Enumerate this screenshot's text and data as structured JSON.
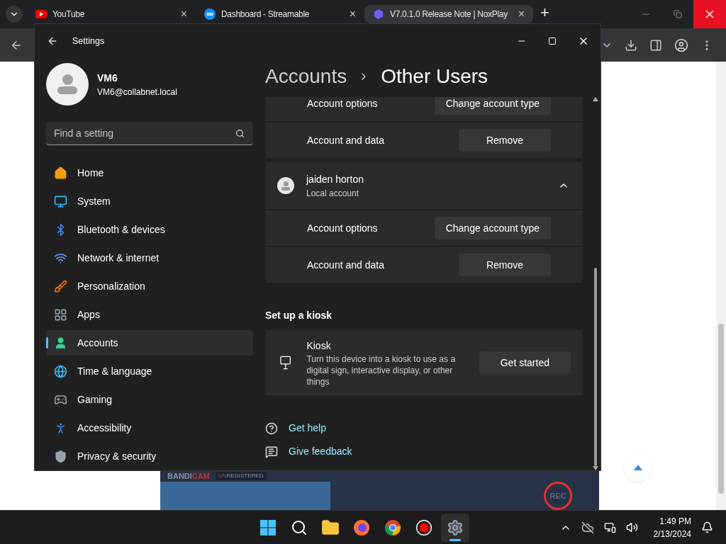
{
  "browser": {
    "tabs": [
      {
        "label": "YouTube",
        "selected": false,
        "close": "×"
      },
      {
        "label": "Dashboard - Streamable",
        "selected": false,
        "close": "×"
      },
      {
        "label": "V7.0.1.0 Release Note | NoxPlay",
        "selected": true,
        "close": "×"
      }
    ],
    "new_tab": "+"
  },
  "settings": {
    "title": "Settings",
    "profile": {
      "name": "VM6",
      "email": "VM6@collabnet.local"
    },
    "search": {
      "placeholder": "Find a setting"
    },
    "nav": [
      {
        "label": "Home",
        "selected": false
      },
      {
        "label": "System",
        "selected": false
      },
      {
        "label": "Bluetooth & devices",
        "selected": false
      },
      {
        "label": "Network & internet",
        "selected": false
      },
      {
        "label": "Personalization",
        "selected": false
      },
      {
        "label": "Apps",
        "selected": false
      },
      {
        "label": "Accounts",
        "selected": true
      },
      {
        "label": "Time & language",
        "selected": false
      },
      {
        "label": "Gaming",
        "selected": false
      },
      {
        "label": "Accessibility",
        "selected": false
      },
      {
        "label": "Privacy & security",
        "selected": false
      }
    ],
    "breadcrumb": [
      "Accounts",
      "Other Users"
    ],
    "previous_user_rows": [
      {
        "label": "Account options",
        "button": "Change account type"
      },
      {
        "label": "Account and data",
        "button": "Remove"
      }
    ],
    "user": {
      "name": "jaiden horton",
      "subtitle": "Local account",
      "expanded": true,
      "rows": [
        {
          "label": "Account options",
          "button": "Change account type"
        },
        {
          "label": "Account and data",
          "button": "Remove"
        }
      ]
    },
    "kiosk": {
      "heading": "Set up a kiosk",
      "title": "Kiosk",
      "description": "Turn this device into a kiosk to use as a digital sign, interactive display, or other things",
      "button": "Get started"
    },
    "links": [
      "Get help",
      "Give feedback"
    ]
  },
  "recorder": {
    "brand": [
      "BANDI",
      "CAM"
    ],
    "status": [
      "UN",
      "REGISTERED"
    ],
    "rec": "REC"
  },
  "taskbar": {
    "apps": [
      {
        "selected": false
      },
      {
        "selected": false
      },
      {
        "selected": false
      },
      {
        "selected": false
      },
      {
        "selected": false
      },
      {
        "selected": false
      },
      {
        "selected": true
      }
    ],
    "time": "1:49 PM",
    "date": "2/13/2024"
  }
}
